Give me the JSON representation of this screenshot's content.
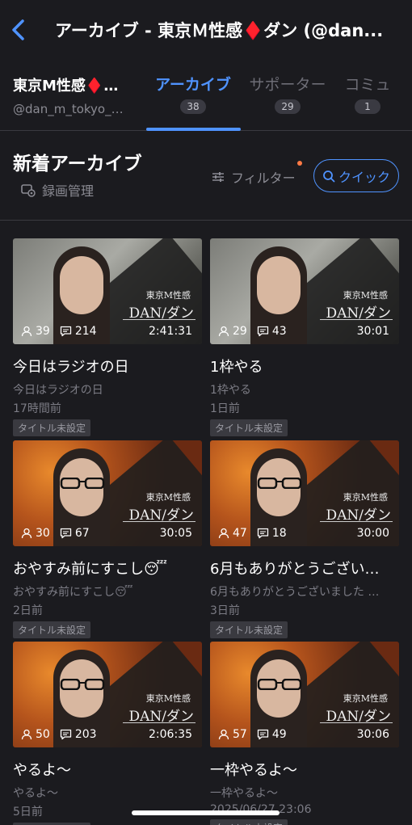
{
  "header": {
    "title": "アーカイブ - 東京Ｍ性感♦️ダン (@dan..."
  },
  "channel": {
    "name": "東京M性感♦️…",
    "handle": "@dan_m_tokyo_…"
  },
  "tabs": [
    {
      "label": "アーカイブ",
      "count": "38",
      "active": true
    },
    {
      "label": "サポーター",
      "count": "29",
      "active": false
    },
    {
      "label": "コミュ",
      "count": "1",
      "active": false
    }
  ],
  "section": {
    "title": "新着アーカイブ",
    "rec_mgmt": "録画管理",
    "filter": "フィルター",
    "quick": "クイック"
  },
  "thumb_text": {
    "brand_small": "東京M性感",
    "brand_big": "DAN/ダン"
  },
  "cards": [
    {
      "viewers": "39",
      "comments": "214",
      "duration": "2:41:31",
      "title": "今日はラジオの日",
      "subtitle": "今日はラジオの日",
      "time": "17時間前",
      "tag": "タイトル未設定",
      "style": "gray"
    },
    {
      "viewers": "29",
      "comments": "43",
      "duration": "30:01",
      "title": "1枠やる",
      "subtitle": "1枠やる",
      "time": "1日前",
      "tag": "タイトル未設定",
      "style": "gray"
    },
    {
      "viewers": "30",
      "comments": "67",
      "duration": "30:05",
      "title": "おやすみ前にすこし😴",
      "subtitle": "おやすみ前にすこし😴",
      "time": "2日前",
      "tag": "タイトル未設定",
      "style": "autumn"
    },
    {
      "viewers": "47",
      "comments": "18",
      "duration": "30:00",
      "title": "6月もありがとうござい…",
      "subtitle": "6月もありがとうございました …",
      "time": "3日前",
      "tag": "タイトル未設定",
      "style": "autumn"
    },
    {
      "viewers": "50",
      "comments": "203",
      "duration": "2:06:35",
      "title": "やるよ〜",
      "subtitle": "やるよ〜",
      "time": "5日前",
      "tag": "タイトル未設定",
      "style": "autumn"
    },
    {
      "viewers": "57",
      "comments": "49",
      "duration": "30:06",
      "title": "一枠やるよ〜",
      "subtitle": "一枠やるよ〜",
      "time": "2025/06/27 23:06",
      "tag": "タイトル未設定",
      "style": "autumn"
    }
  ],
  "colors": {
    "accent": "#4f93ff",
    "background": "#1b1b1f",
    "notice_dot": "#ff7a45"
  }
}
